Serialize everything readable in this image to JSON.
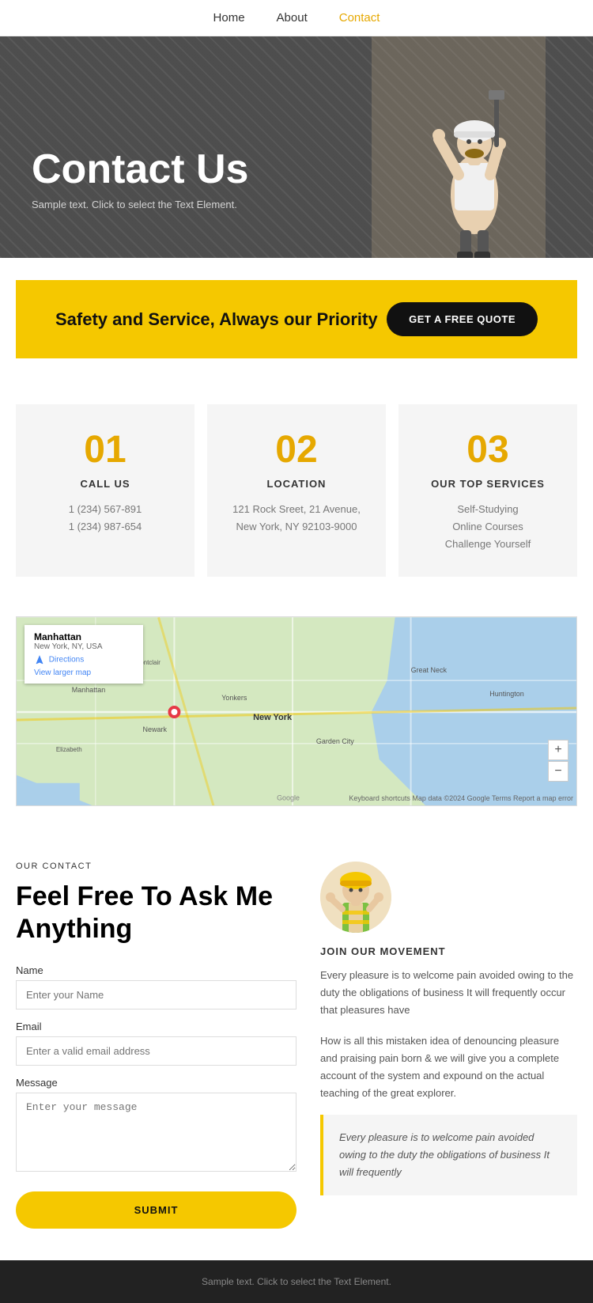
{
  "nav": {
    "items": [
      {
        "label": "Home",
        "active": false
      },
      {
        "label": "About",
        "active": false
      },
      {
        "label": "Contact",
        "active": true
      }
    ]
  },
  "hero": {
    "title": "Contact Us",
    "subtitle": "Sample text. Click to select the Text Element."
  },
  "banner": {
    "heading": "Safety and Service, Always our Priority",
    "button_label": "GET A FREE QUOTE"
  },
  "cards": [
    {
      "number": "01",
      "title": "CALL US",
      "lines": [
        "1 (234) 567-891",
        "1 (234) 987-654"
      ]
    },
    {
      "number": "02",
      "title": "LOCATION",
      "lines": [
        "121 Rock Sreet, 21 Avenue,",
        "New York, NY 92103-9000"
      ]
    },
    {
      "number": "03",
      "title": "OUR TOP SERVICES",
      "lines": [
        "Self-Studying",
        "Online Courses",
        "Challenge Yourself"
      ]
    }
  ],
  "map": {
    "location_name": "Manhattan",
    "location_sub": "New York, NY, USA",
    "directions_label": "Directions",
    "larger_map_label": "View larger map",
    "zoom_in": "+",
    "zoom_out": "−",
    "footer_text": "Keyboard shortcuts   Map data ©2024 Google   Terms   Report a map error"
  },
  "contact": {
    "our_contact_label": "OUR CONTACT",
    "heading": "Feel Free To Ask Me Anything",
    "form": {
      "name_label": "Name",
      "name_placeholder": "Enter your Name",
      "email_label": "Email",
      "email_placeholder": "Enter a valid email address",
      "message_label": "Message",
      "message_placeholder": "Enter your message",
      "submit_label": "SUBMIT"
    },
    "right": {
      "join_title": "JOIN OUR MOVEMENT",
      "para1": "Every pleasure is to welcome pain avoided owing to the duty the obligations of business It will frequently occur that pleasures have",
      "para2": "How is all this mistaken idea of denouncing pleasure and praising pain born & we will give you a complete account of the system and expound on the actual teaching of the great explorer.",
      "quote": "Every pleasure is to welcome pain avoided owing to the duty the obligations of business It will frequently"
    }
  },
  "footer": {
    "text": "Sample text. Click to select the Text Element."
  }
}
